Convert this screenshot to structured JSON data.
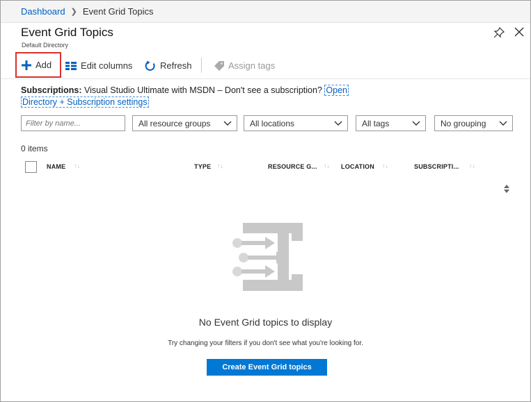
{
  "breadcrumb": {
    "items": [
      {
        "label": "Dashboard"
      },
      {
        "label": "Event Grid Topics"
      }
    ]
  },
  "header": {
    "title": "Event Grid Topics",
    "subtitle": "Default Directory"
  },
  "toolbar": {
    "add_label": "Add",
    "edit_columns_label": "Edit columns",
    "refresh_label": "Refresh",
    "assign_tags_label": "Assign tags"
  },
  "subscriptions": {
    "label": "Subscriptions:",
    "text": "Visual Studio Ultimate with MSDN – Don't see a subscription?",
    "link_line1": "Open",
    "link_line2": "Directory + Subscription settings"
  },
  "filters": {
    "name_placeholder": "Filter by name...",
    "resource_groups": "All resource groups",
    "locations": "All locations",
    "tags": "All tags",
    "grouping": "No grouping"
  },
  "grid": {
    "count": "0 items",
    "columns": [
      {
        "label": "NAME"
      },
      {
        "label": "TYPE"
      },
      {
        "label": "RESOURCE G..."
      },
      {
        "label": "LOCATION"
      },
      {
        "label": "SUBSCRIPTI..."
      }
    ]
  },
  "empty_state": {
    "title": "No Event Grid topics to display",
    "hint": "Try changing your filters if you don't see what you're looking for.",
    "button_label": "Create Event Grid topics"
  },
  "colors": {
    "accent": "#0078d4",
    "link": "#0060c0",
    "highlight_border": "#d9302d",
    "illustration_gray": "#c8c8c8"
  },
  "icons": [
    "pin-icon",
    "close-icon",
    "plus-icon",
    "columns-icon",
    "refresh-icon",
    "tag-icon",
    "chevron-down-icon",
    "sort-icon",
    "event-grid-icon"
  ]
}
